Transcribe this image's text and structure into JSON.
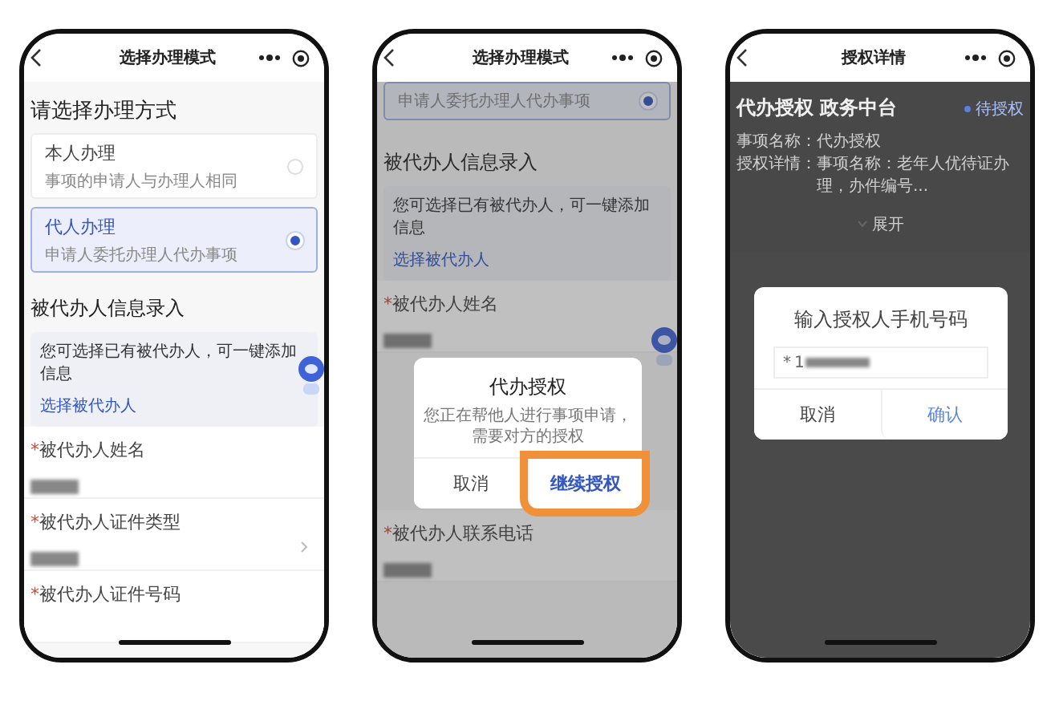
{
  "phones": [
    {
      "nav": {
        "title": "选择办理模式"
      },
      "floating_assistant": true,
      "heading": "请选择办理方式",
      "options": [
        {
          "title": "本人办理",
          "desc": "事项的申请人与办理人相同",
          "selected": false
        },
        {
          "title": "代人办理",
          "desc": "申请人委托办理人代办事项",
          "selected": true
        }
      ],
      "section": "被代办人信息录入",
      "notice": {
        "text": "您可选择已有被代办人，可一键添加信息",
        "link": "选择被代办人"
      },
      "fields": [
        {
          "mark": "*",
          "label": "被代办人姓名",
          "value_blurred": true,
          "has_chevron": false
        },
        {
          "mark": "*",
          "label": "被代办人证件类型",
          "value_blurred": true,
          "has_chevron": true
        },
        {
          "mark": "*",
          "label": "被代办人证件号码",
          "value_blurred": false,
          "has_chevron": false
        }
      ]
    },
    {
      "nav": {
        "title": "选择办理模式"
      },
      "floating_assistant": true,
      "options": [
        {
          "desc": "申请人委托办理人代办事项",
          "selected": true
        }
      ],
      "section": "被代办人信息录入",
      "notice": {
        "text": "您可选择已有被代办人，可一键添加信息",
        "link": "选择被代办人"
      },
      "fields": [
        {
          "mark": "*",
          "label": "被代办人姓名",
          "value_blurred": true,
          "has_chevron": false
        },
        {
          "mark": "*",
          "label": "被代办人联系电话",
          "value_blurred": true,
          "has_chevron": false
        }
      ],
      "dialog": {
        "kind": "confirm",
        "title": "代办授权",
        "message": "您正在帮他人进行事项申请，需要对方的授权",
        "buttons": [
          {
            "label": "取消",
            "primary": false,
            "highlighted": false
          },
          {
            "label": "继续授权",
            "primary": true,
            "highlighted": true
          }
        ]
      }
    },
    {
      "nav": {
        "title": "授权详情"
      },
      "floating_assistant": false,
      "detail": {
        "title": "代办授权 政务中台",
        "status": "待授权",
        "rows": [
          {
            "label": "事项名称：",
            "value": "代办授权"
          },
          {
            "label": "授权详情：",
            "value": "事项名称：老年人优待证办理，办件编号..."
          }
        ],
        "expand": "展开"
      },
      "dialog": {
        "kind": "prompt",
        "title": "输入授权人手机号码",
        "input": {
          "mark": "*",
          "value": "1",
          "value_blurred": true
        },
        "buttons": [
          {
            "label": "取消",
            "primary": false,
            "highlighted": false
          },
          {
            "label": "确认",
            "primary": true,
            "highlighted": false
          }
        ]
      }
    }
  ]
}
